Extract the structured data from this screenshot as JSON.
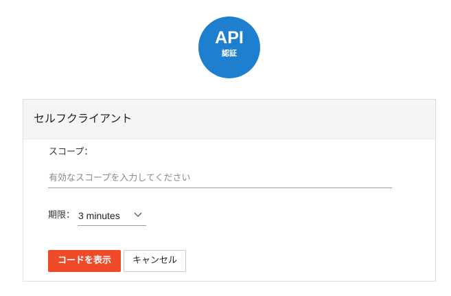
{
  "logo": {
    "main": "API",
    "sub": "認証",
    "color": "#1f7fcf"
  },
  "panel": {
    "title": "セルフクライアント",
    "scope": {
      "label": "スコープ：",
      "value": "",
      "placeholder": "有効なスコープを入力してください"
    },
    "expiry": {
      "label": "期限：",
      "selected": "3 minutes",
      "icon": "chevron-down-icon"
    },
    "buttons": {
      "show_code": "コードを表示",
      "cancel": "キャンセル"
    },
    "colors": {
      "primary_button": "#ef4b2b",
      "header_background": "#f5f5f5"
    }
  }
}
